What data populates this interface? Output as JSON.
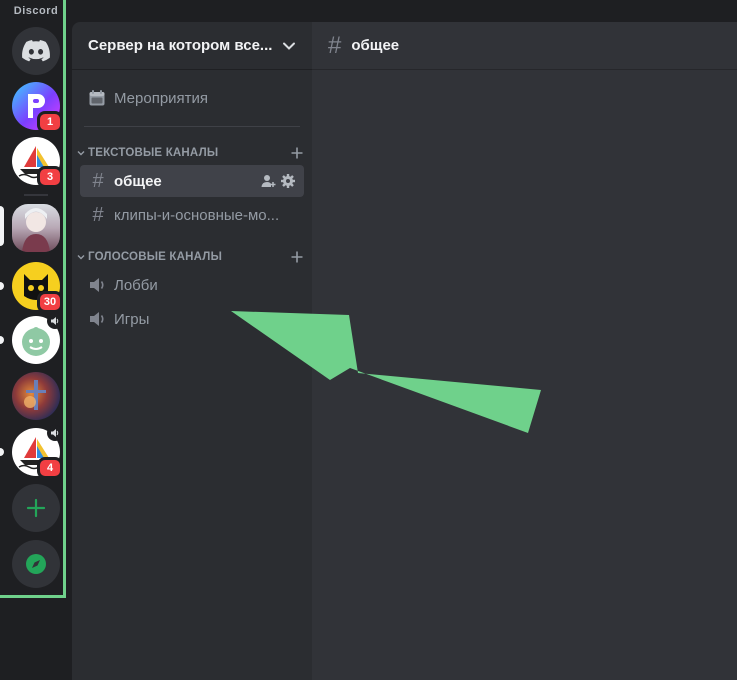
{
  "app": {
    "name": "Discord"
  },
  "guilds": [
    {
      "name": "home",
      "badge": ""
    },
    {
      "name": "server-p",
      "badge": "1"
    },
    {
      "name": "server-sail-1",
      "badge": "3"
    },
    {
      "name": "server-portrait",
      "badge": ""
    },
    {
      "name": "server-yellow",
      "badge": "30"
    },
    {
      "name": "server-green-bot",
      "badge": ""
    },
    {
      "name": "server-art",
      "badge": ""
    },
    {
      "name": "server-sail-2",
      "badge": "4"
    }
  ],
  "server": {
    "name": "Сервер на котором все...",
    "events_label": "Мероприятия"
  },
  "categories": {
    "text": "ТЕКСТОВЫЕ КАНАЛЫ",
    "voice": "ГОЛОСОВЫЕ КАНАЛЫ"
  },
  "text_channels": [
    {
      "name": "общее"
    },
    {
      "name": "клипы-и-основные-мо..."
    }
  ],
  "voice_channels": [
    {
      "name": "Лобби"
    },
    {
      "name": "Игры"
    }
  ],
  "main": {
    "channel_title": "общее"
  },
  "colors": {
    "accent_green": "#6fd18b",
    "discord_blurple": "#5865f2",
    "badge_red": "#f23f43"
  }
}
